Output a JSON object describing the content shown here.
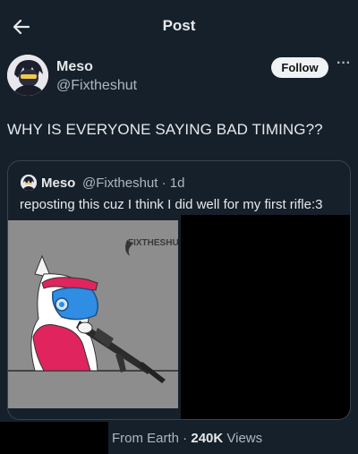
{
  "header": {
    "title": "Post",
    "back_icon": "arrow-left-icon"
  },
  "author": {
    "name": "Meso",
    "handle": "@Fixtheshut",
    "follow_label": "Follow",
    "more_icon": "more-horizontal-icon",
    "more_glyph": "···"
  },
  "post": {
    "text": "WHY IS EVERYONE SAYING BAD TIMING??"
  },
  "quote": {
    "name": "Meso",
    "handle_time": "@Fixtheshut · 1d",
    "text": "reposting this cuz I think I did well for my first rifle:3",
    "watermark": "FIXTHESHU"
  },
  "meta": {
    "location": "From Earth · ",
    "views_count": "240K",
    "views_label": " Views"
  },
  "colors": {
    "background": "#15202b",
    "text": "#e7e9ea",
    "secondary": "#aab8c2",
    "accent_pink": "#e0245e",
    "visor_blue": "#2f8de4"
  }
}
